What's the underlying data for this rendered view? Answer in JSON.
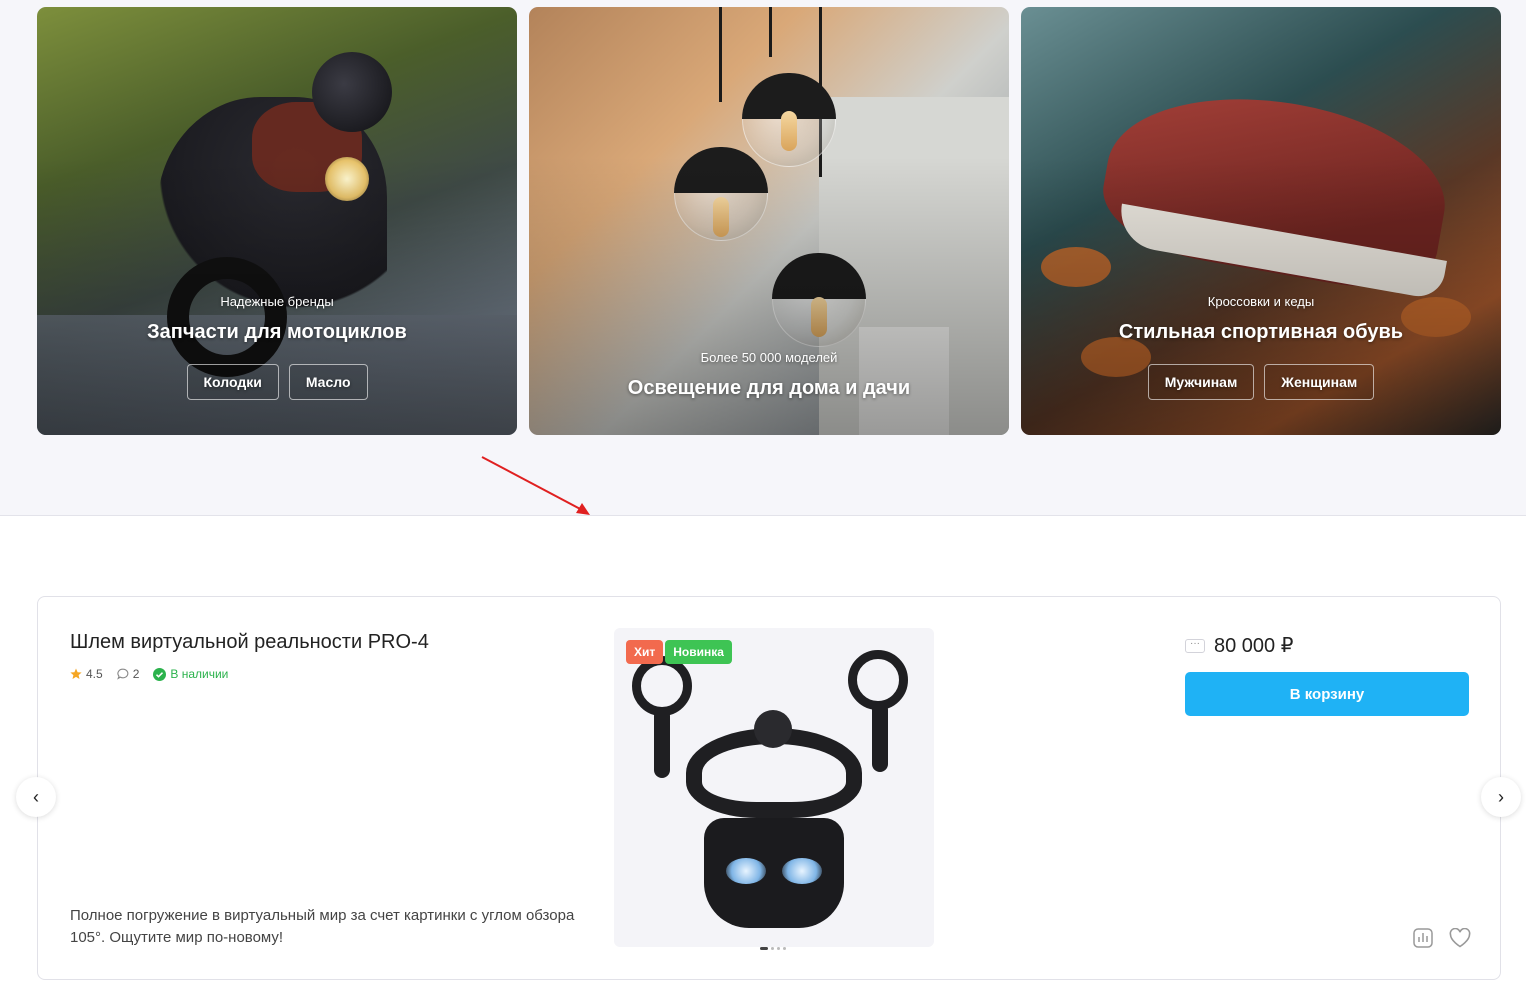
{
  "banners": [
    {
      "subtitle": "Надежные бренды",
      "title": "Запчасти для мотоциклов",
      "chips": [
        "Колодки",
        "Масло"
      ]
    },
    {
      "subtitle": "Более 50 000 моделей",
      "title": "Освещение для дома и дачи",
      "chips": []
    },
    {
      "subtitle": "Кроссовки и кеды",
      "title": "Стильная спортивная обувь",
      "chips": [
        "Мужчинам",
        "Женщинам"
      ]
    }
  ],
  "product": {
    "title": "Шлем виртуальной реальности PRO-4",
    "rating": "4.5",
    "reviews": "2",
    "stock": "В наличии",
    "badges": [
      "Хит",
      "Новинка"
    ],
    "description": "Полное погружение в виртуальный мир за счет картинки с углом обзора 105°. Ощутите мир по-новому!",
    "more_icon": "···",
    "price": "80 000 ₽",
    "cart_label": "В корзину"
  },
  "nav": {
    "prev": "‹",
    "next": "›"
  },
  "colors": {
    "accent": "#1fb2f5",
    "hit": "#f26a4e",
    "new": "#3ec454",
    "stock": "#2bb24c",
    "annotation_arrow": "#e02020"
  }
}
